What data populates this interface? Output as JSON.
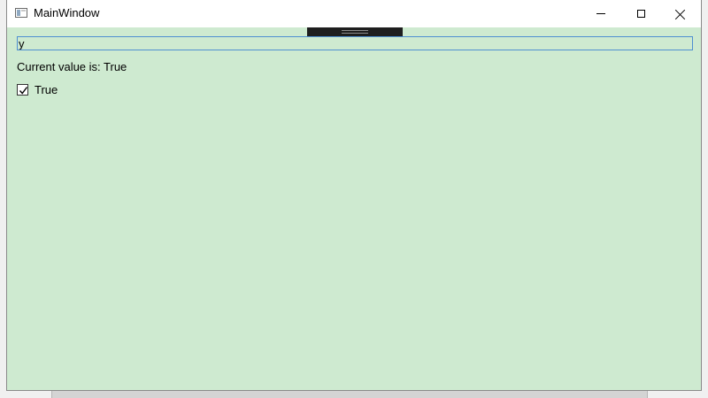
{
  "window": {
    "title": "MainWindow",
    "background": "#ceead0",
    "icons": {
      "app": "window-app-icon",
      "minimize": "minimize-icon",
      "maximize": "maximize-icon",
      "close": "close-icon"
    }
  },
  "main": {
    "textbox_value": "y",
    "value_label": "Current value is: True",
    "checkbox": {
      "label": "True",
      "checked": true
    }
  }
}
